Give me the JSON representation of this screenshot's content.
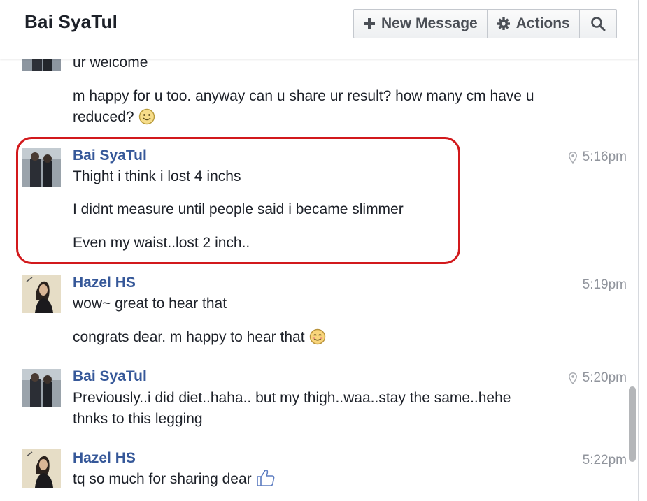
{
  "header": {
    "title": "Bai SyaTul",
    "new_message_label": "New Message",
    "actions_label": "Actions"
  },
  "messages": [
    {
      "sender": "",
      "lines": [
        "ur welcome",
        "m happy for u too. anyway can u share ur result? how many cm have u",
        "reduced?"
      ],
      "emoji": "smile-emoji"
    },
    {
      "sender": "Bai SyaTul",
      "time": "5:16pm",
      "location_pin": true,
      "lines": [
        "Thight i think i lost 4 inchs",
        "I didnt measure until people said i became slimmer",
        "Even my waist..lost 2 inch.."
      ]
    },
    {
      "sender": "Hazel HS",
      "time": "5:19pm",
      "lines": [
        "wow~ great to hear that",
        "congrats dear. m happy to hear that"
      ],
      "emoji": "blush-emoji"
    },
    {
      "sender": "Bai SyaTul",
      "time": "5:20pm",
      "location_pin": true,
      "lines": [
        "Previously..i did diet..haha.. but my thigh..waa..stay the same..hehe",
        "thnks to this legging"
      ]
    },
    {
      "sender": "Hazel HS",
      "time": "5:22pm",
      "lines": [
        "tq so much for sharing dear"
      ],
      "emoji": "thumbs-up-emoji"
    }
  ],
  "colors": {
    "sender_name": "#365899",
    "highlight_border": "#d2191c",
    "timestamp": "#90949c"
  }
}
